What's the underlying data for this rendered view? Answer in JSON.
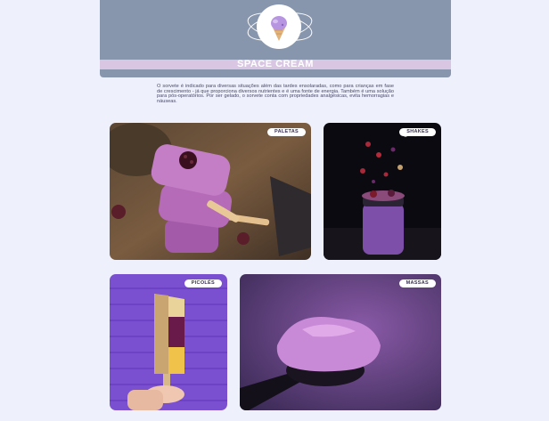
{
  "header": {
    "title": "SPACE CREAM",
    "colors": {
      "background": "#8896ad",
      "band": "#d8c6e2",
      "page": "#eef0fc"
    }
  },
  "logo": {
    "icon": "ice-cream-planet-icon"
  },
  "intro": "O sorvete é indicado para diversas situações além das tardes ensolaradas, como para crianças em fase de crescimento - já que proporciona diversos nutrientes e é uma fonte de energia. Também é uma solução para pós-operatórios. Por ser gelado, o sorvete conta com propriedades analgésicas, evita hemorragias e náuseas.",
  "cards": [
    {
      "tag": "PALETAS"
    },
    {
      "tag": "SHAKES"
    },
    {
      "tag": "PICOLÉS"
    },
    {
      "tag": "MASSAS"
    }
  ]
}
